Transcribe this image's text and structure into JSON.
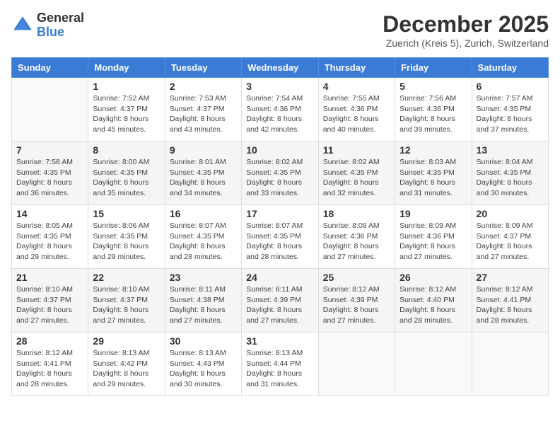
{
  "logo": {
    "general": "General",
    "blue": "Blue"
  },
  "title": "December 2025",
  "subtitle": "Zuerich (Kreis 5), Zurich, Switzerland",
  "headers": [
    "Sunday",
    "Monday",
    "Tuesday",
    "Wednesday",
    "Thursday",
    "Friday",
    "Saturday"
  ],
  "weeks": [
    [
      {
        "day": "",
        "sunrise": "",
        "sunset": "",
        "daylight": "",
        "empty": true
      },
      {
        "day": "1",
        "sunrise": "Sunrise: 7:52 AM",
        "sunset": "Sunset: 4:37 PM",
        "daylight": "Daylight: 8 hours and 45 minutes."
      },
      {
        "day": "2",
        "sunrise": "Sunrise: 7:53 AM",
        "sunset": "Sunset: 4:37 PM",
        "daylight": "Daylight: 8 hours and 43 minutes."
      },
      {
        "day": "3",
        "sunrise": "Sunrise: 7:54 AM",
        "sunset": "Sunset: 4:36 PM",
        "daylight": "Daylight: 8 hours and 42 minutes."
      },
      {
        "day": "4",
        "sunrise": "Sunrise: 7:55 AM",
        "sunset": "Sunset: 4:36 PM",
        "daylight": "Daylight: 8 hours and 40 minutes."
      },
      {
        "day": "5",
        "sunrise": "Sunrise: 7:56 AM",
        "sunset": "Sunset: 4:36 PM",
        "daylight": "Daylight: 8 hours and 39 minutes."
      },
      {
        "day": "6",
        "sunrise": "Sunrise: 7:57 AM",
        "sunset": "Sunset: 4:35 PM",
        "daylight": "Daylight: 8 hours and 37 minutes."
      }
    ],
    [
      {
        "day": "7",
        "sunrise": "Sunrise: 7:58 AM",
        "sunset": "Sunset: 4:35 PM",
        "daylight": "Daylight: 8 hours and 36 minutes."
      },
      {
        "day": "8",
        "sunrise": "Sunrise: 8:00 AM",
        "sunset": "Sunset: 4:35 PM",
        "daylight": "Daylight: 8 hours and 35 minutes."
      },
      {
        "day": "9",
        "sunrise": "Sunrise: 8:01 AM",
        "sunset": "Sunset: 4:35 PM",
        "daylight": "Daylight: 8 hours and 34 minutes."
      },
      {
        "day": "10",
        "sunrise": "Sunrise: 8:02 AM",
        "sunset": "Sunset: 4:35 PM",
        "daylight": "Daylight: 8 hours and 33 minutes."
      },
      {
        "day": "11",
        "sunrise": "Sunrise: 8:02 AM",
        "sunset": "Sunset: 4:35 PM",
        "daylight": "Daylight: 8 hours and 32 minutes."
      },
      {
        "day": "12",
        "sunrise": "Sunrise: 8:03 AM",
        "sunset": "Sunset: 4:35 PM",
        "daylight": "Daylight: 8 hours and 31 minutes."
      },
      {
        "day": "13",
        "sunrise": "Sunrise: 8:04 AM",
        "sunset": "Sunset: 4:35 PM",
        "daylight": "Daylight: 8 hours and 30 minutes."
      }
    ],
    [
      {
        "day": "14",
        "sunrise": "Sunrise: 8:05 AM",
        "sunset": "Sunset: 4:35 PM",
        "daylight": "Daylight: 8 hours and 29 minutes."
      },
      {
        "day": "15",
        "sunrise": "Sunrise: 8:06 AM",
        "sunset": "Sunset: 4:35 PM",
        "daylight": "Daylight: 8 hours and 29 minutes."
      },
      {
        "day": "16",
        "sunrise": "Sunrise: 8:07 AM",
        "sunset": "Sunset: 4:35 PM",
        "daylight": "Daylight: 8 hours and 28 minutes."
      },
      {
        "day": "17",
        "sunrise": "Sunrise: 8:07 AM",
        "sunset": "Sunset: 4:35 PM",
        "daylight": "Daylight: 8 hours and 28 minutes."
      },
      {
        "day": "18",
        "sunrise": "Sunrise: 8:08 AM",
        "sunset": "Sunset: 4:36 PM",
        "daylight": "Daylight: 8 hours and 27 minutes."
      },
      {
        "day": "19",
        "sunrise": "Sunrise: 8:09 AM",
        "sunset": "Sunset: 4:36 PM",
        "daylight": "Daylight: 8 hours and 27 minutes."
      },
      {
        "day": "20",
        "sunrise": "Sunrise: 8:09 AM",
        "sunset": "Sunset: 4:37 PM",
        "daylight": "Daylight: 8 hours and 27 minutes."
      }
    ],
    [
      {
        "day": "21",
        "sunrise": "Sunrise: 8:10 AM",
        "sunset": "Sunset: 4:37 PM",
        "daylight": "Daylight: 8 hours and 27 minutes."
      },
      {
        "day": "22",
        "sunrise": "Sunrise: 8:10 AM",
        "sunset": "Sunset: 4:37 PM",
        "daylight": "Daylight: 8 hours and 27 minutes."
      },
      {
        "day": "23",
        "sunrise": "Sunrise: 8:11 AM",
        "sunset": "Sunset: 4:38 PM",
        "daylight": "Daylight: 8 hours and 27 minutes."
      },
      {
        "day": "24",
        "sunrise": "Sunrise: 8:11 AM",
        "sunset": "Sunset: 4:39 PM",
        "daylight": "Daylight: 8 hours and 27 minutes."
      },
      {
        "day": "25",
        "sunrise": "Sunrise: 8:12 AM",
        "sunset": "Sunset: 4:39 PM",
        "daylight": "Daylight: 8 hours and 27 minutes."
      },
      {
        "day": "26",
        "sunrise": "Sunrise: 8:12 AM",
        "sunset": "Sunset: 4:40 PM",
        "daylight": "Daylight: 8 hours and 28 minutes."
      },
      {
        "day": "27",
        "sunrise": "Sunrise: 8:12 AM",
        "sunset": "Sunset: 4:41 PM",
        "daylight": "Daylight: 8 hours and 28 minutes."
      }
    ],
    [
      {
        "day": "28",
        "sunrise": "Sunrise: 8:12 AM",
        "sunset": "Sunset: 4:41 PM",
        "daylight": "Daylight: 8 hours and 28 minutes."
      },
      {
        "day": "29",
        "sunrise": "Sunrise: 8:13 AM",
        "sunset": "Sunset: 4:42 PM",
        "daylight": "Daylight: 8 hours and 29 minutes."
      },
      {
        "day": "30",
        "sunrise": "Sunrise: 8:13 AM",
        "sunset": "Sunset: 4:43 PM",
        "daylight": "Daylight: 8 hours and 30 minutes."
      },
      {
        "day": "31",
        "sunrise": "Sunrise: 8:13 AM",
        "sunset": "Sunset: 4:44 PM",
        "daylight": "Daylight: 8 hours and 31 minutes."
      },
      {
        "day": "",
        "sunrise": "",
        "sunset": "",
        "daylight": "",
        "empty": true
      },
      {
        "day": "",
        "sunrise": "",
        "sunset": "",
        "daylight": "",
        "empty": true
      },
      {
        "day": "",
        "sunrise": "",
        "sunset": "",
        "daylight": "",
        "empty": true
      }
    ]
  ]
}
